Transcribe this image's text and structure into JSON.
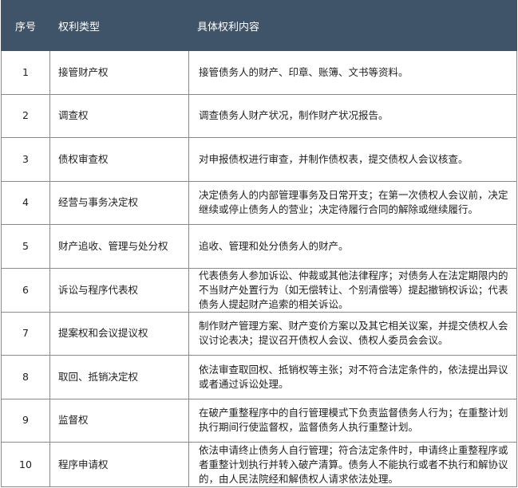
{
  "table": {
    "headers": {
      "no": "序号",
      "type": "权利类型",
      "content": "具体权利内容"
    },
    "rows": [
      {
        "no": "1",
        "type": "接管财产权",
        "content": "接管债务人的财产、印章、账簿、文书等资料。"
      },
      {
        "no": "2",
        "type": "调查权",
        "content": "调查债务人财产状况，制作财产状况报告。"
      },
      {
        "no": "3",
        "type": "债权审查权",
        "content": "对申报债权进行审查，并制作债权表，提交债权人会议核查。"
      },
      {
        "no": "4",
        "type": "经营与事务决定权",
        "content": "决定债务人的内部管理事务及日常开支；在第一次债权人会议前，决定继续或停止债务人的营业；决定待履行合同的解除或继续履行。"
      },
      {
        "no": "5",
        "type": "财产追收、管理与处分权",
        "content": "追收、管理和处分债务人的财产。"
      },
      {
        "no": "6",
        "type": "诉讼与程序代表权",
        "content": "代表债务人参加诉讼、仲裁或其他法律程序；对债务人在法定期限内的不当财产处置行为（如无偿转让、个别清偿等）提起撤销权诉讼；代表债务人提起财产追索的相关诉讼。"
      },
      {
        "no": "7",
        "type": "提案权和会议提议权",
        "content": "制作财产管理方案、财产变价方案以及其它相关议案，并提交债权人会议讨论表决；提议召开债权人会议、债权人委员会会议。"
      },
      {
        "no": "8",
        "type": "取回、抵销决定权",
        "content": "依法审查取回权、抵销权等主张；对不符合法定条件的，依法提出异议或者通过诉讼处理。"
      },
      {
        "no": "9",
        "type": "监督权",
        "content": "在破产重整程序中的自行管理模式下负责监督债务人行为；在重整计划执行期间行使监督权，监督债务人执行重整计划。"
      },
      {
        "no": "10",
        "type": "程序申请权",
        "content": "依法申请终止债务人自行管理；符合法定条件时，申请终止重整程序或者重整计划执行并转入破产清算。债务人不能执行或者不执行和解协议的，由人民法院经和解债权人请求依法处理。"
      }
    ]
  },
  "colors": {
    "header_bg": "#3f5468",
    "header_text": "#ffffff",
    "border": "#8a8a8a"
  }
}
